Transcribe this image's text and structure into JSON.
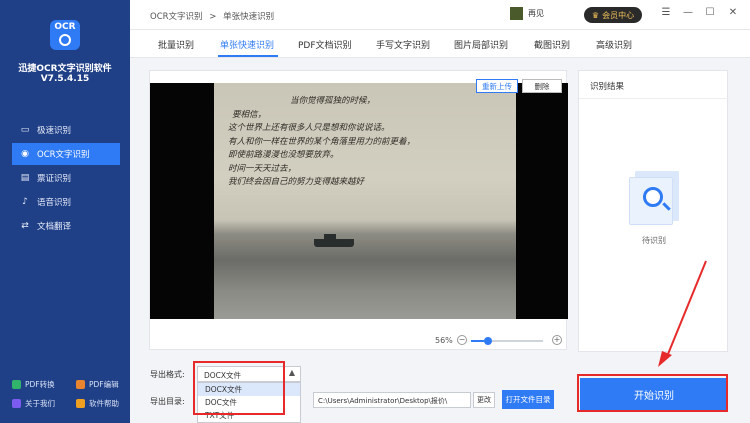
{
  "app": {
    "name": "迅捷OCR文字识别软件",
    "version": "V7.5.4.15",
    "logo_text": "OCR"
  },
  "sidebar": {
    "items": [
      {
        "label": "极速识别",
        "icon": "monitor-icon",
        "active": false
      },
      {
        "label": "OCR文字识别",
        "icon": "eye-icon",
        "active": true
      },
      {
        "label": "票证识别",
        "icon": "ticket-icon",
        "active": false
      },
      {
        "label": "语音识别",
        "icon": "microphone-icon",
        "active": false
      },
      {
        "label": "文档翻译",
        "icon": "translate-icon",
        "active": false
      }
    ],
    "bottom_links": [
      {
        "label": "PDF转换",
        "icon": "pdf-convert-icon",
        "color": "#32b36b"
      },
      {
        "label": "PDF编辑",
        "icon": "pdf-edit-icon",
        "color": "#e9842f"
      },
      {
        "label": "关于我们",
        "icon": "info-icon",
        "color": "#7c5cf0"
      },
      {
        "label": "软件帮助",
        "icon": "help-icon",
        "color": "#f0a020"
      }
    ]
  },
  "header": {
    "breadcrumb": [
      "OCR文字识别",
      "单张快速识别"
    ],
    "breadcrumb_separator": ">",
    "user_name": "再见",
    "vip_label": "会员中心",
    "window_controls": [
      "☰",
      "—",
      "☐",
      "✕"
    ]
  },
  "tabs": [
    {
      "label": "批量识别",
      "active": false
    },
    {
      "label": "单张快速识别",
      "active": true
    },
    {
      "label": "PDF文档识别",
      "active": false
    },
    {
      "label": "手写文字识别",
      "active": false
    },
    {
      "label": "图片局部识别",
      "active": false
    },
    {
      "label": "截图识别",
      "active": false
    },
    {
      "label": "高级识别",
      "active": false
    }
  ],
  "image_panel": {
    "reupload_label": "重新上传",
    "delete_label": "删除",
    "poem_lines": [
      "当你觉得孤独的时候，",
      "要相信，",
      "这个世界上还有很多人只是想和你说说话。",
      "有人和你一样在世界的某个角落里用力的前更着，",
      "即使前路漫漫也没想要放弃。",
      "时间一天天过去，",
      "我们终会因自己的努力变得越来越好"
    ],
    "zoom_label": "56%",
    "zoom_value": 0.56,
    "zoom_minus": "−",
    "zoom_plus": "+"
  },
  "result_panel": {
    "title": "识别结果",
    "status": "待识别"
  },
  "export": {
    "format_label": "导出格式:",
    "format_value": "DOCX文件",
    "format_options": [
      "DOCX文件",
      "DOC文件",
      "TXT文件"
    ],
    "highlighted_option": 0,
    "dir_label": "导出目录:",
    "dir_value": "C:\\Users\\Administrator\\Desktop\\报价\\",
    "change_label": "更改",
    "open_dir_label": "打开文件目录",
    "start_label": "开始识别"
  },
  "colors": {
    "sidebar_bg": "#1f3f86",
    "accent": "#2f7bf5",
    "annotation_red": "#e62a2a"
  }
}
